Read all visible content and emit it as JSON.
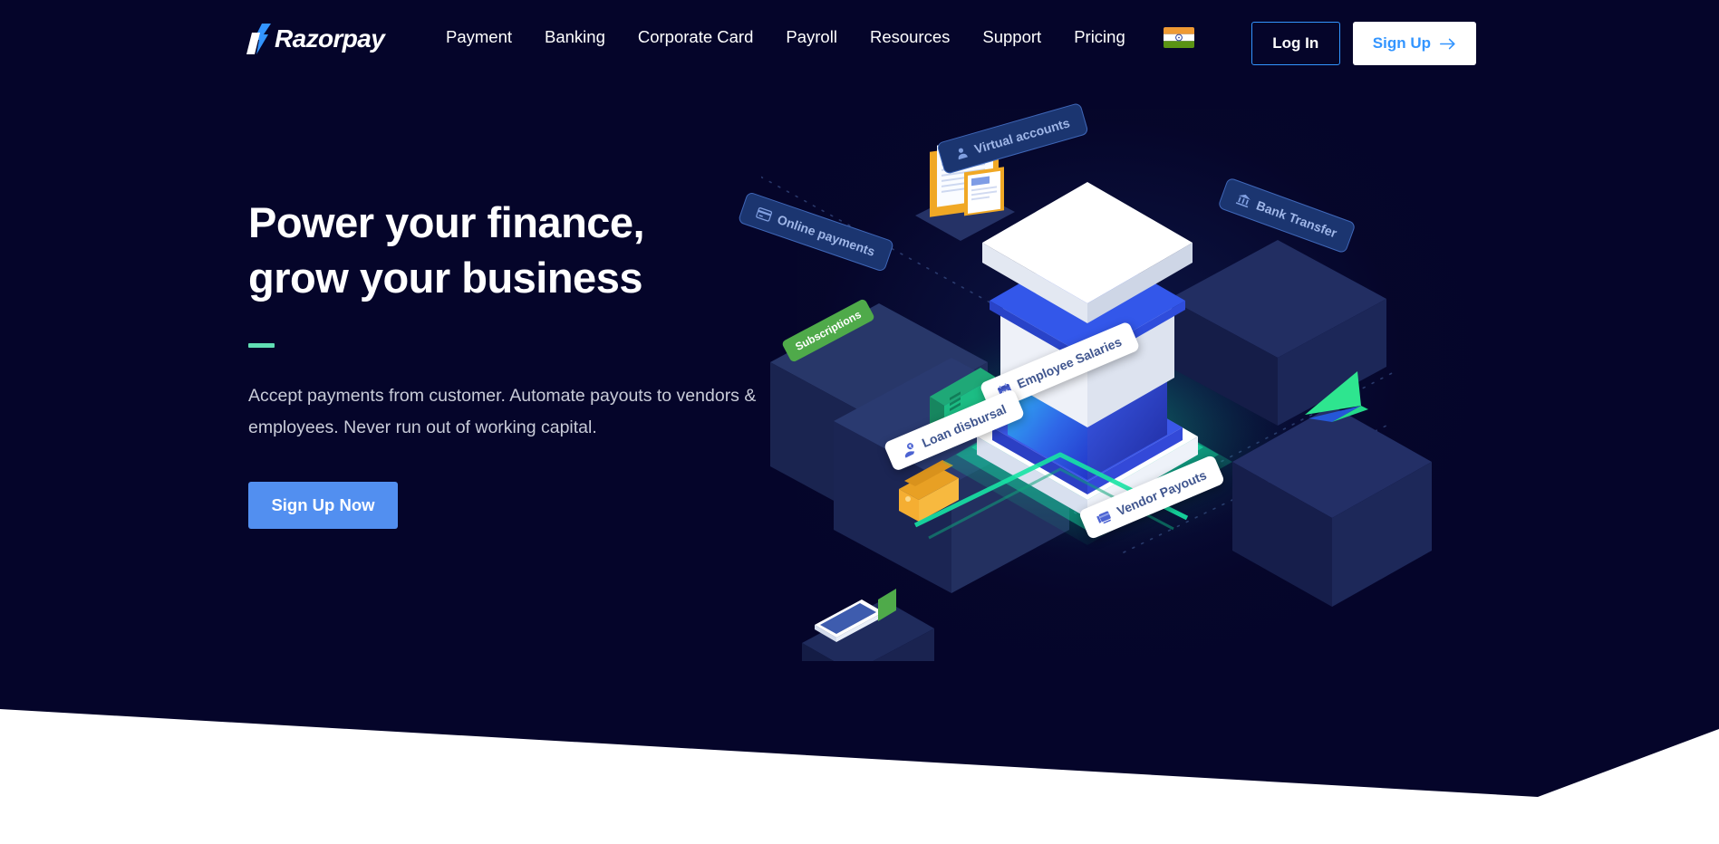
{
  "brand": {
    "name": "Razorpay",
    "logo_icon": "razorpay-logo-icon",
    "accent_blue": "#3395ff",
    "accent_green": "#61dfb4",
    "background": "#05052a"
  },
  "nav": {
    "links": [
      {
        "label": "Payment"
      },
      {
        "label": "Banking"
      },
      {
        "label": "Corporate Card"
      },
      {
        "label": "Payroll"
      },
      {
        "label": "Resources"
      },
      {
        "label": "Support"
      },
      {
        "label": "Pricing"
      }
    ],
    "locale_flag": "india-flag-icon",
    "login_label": "Log In",
    "signup_label": "Sign Up",
    "signup_icon": "arrow-right-icon"
  },
  "hero": {
    "title_line1": "Power your finance,",
    "title_line2": "grow your business",
    "subtitle": "Accept payments from customer. Automate payouts to vendors & employees. Never run out of working capital.",
    "cta_label": "Sign Up Now"
  },
  "illustration": {
    "alt": "isometric banking platform illustration",
    "labels": [
      {
        "text": "Virtual accounts",
        "icon": "user-icon",
        "style": "dark"
      },
      {
        "text": "Online payments",
        "icon": "credit-card-icon",
        "style": "dark"
      },
      {
        "text": "Bank Transfer",
        "icon": "bank-icon",
        "style": "dark"
      },
      {
        "text": "Subscriptions",
        "icon": "none",
        "style": "green"
      },
      {
        "text": "Employee Salaries",
        "icon": "calendar-icon",
        "style": "light"
      },
      {
        "text": "Loan disbursal",
        "icon": "loan-icon",
        "style": "light"
      },
      {
        "text": "Vendor Payouts",
        "icon": "payout-card-icon",
        "style": "light"
      }
    ]
  }
}
